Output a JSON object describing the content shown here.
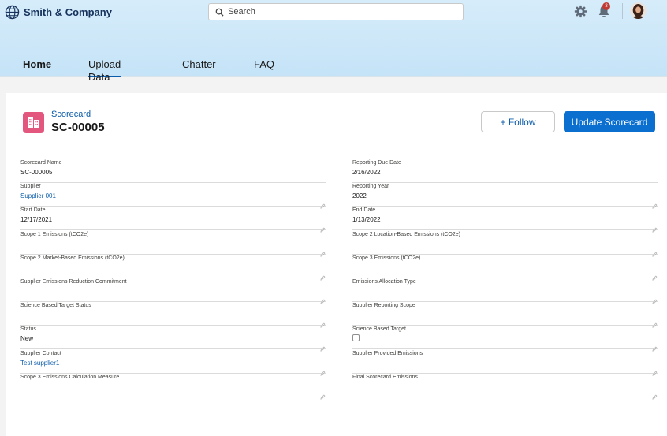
{
  "header": {
    "brand": "Smith & Company",
    "search_placeholder": "Search",
    "notification_count": "3"
  },
  "nav": {
    "items": [
      "Home",
      "Upload Data",
      "Chatter",
      "FAQ"
    ],
    "active": "Upload Data"
  },
  "record": {
    "type_label": "Scorecard",
    "name": "SC-00005",
    "follow_label": "+ Follow",
    "update_label": "Update Scorecard"
  },
  "fields_left": [
    {
      "label": "Scorecard Name",
      "value": "SC-000005"
    },
    {
      "label": "Supplier",
      "value": "Supplier 001"
    },
    {
      "label": "Start Date",
      "value": "12/17/2021"
    },
    {
      "label": "Scope 1 Emissions (tCO2e)",
      "value": ""
    },
    {
      "label": "Scope 2 Market-Based Emissions (tCO2e)",
      "value": ""
    },
    {
      "label": "Supplier Emissions Reduction Commitment",
      "value": ""
    },
    {
      "label": "Science Based Target Status",
      "value": ""
    },
    {
      "label": "Status",
      "value": "New"
    },
    {
      "label": "Supplier Contact",
      "value": "Test supplier1"
    },
    {
      "label": "Scope 3 Emissions Calculation Measure",
      "value": ""
    }
  ],
  "fields_right": [
    {
      "label": "Reporting Due Date",
      "value": "2/16/2022"
    },
    {
      "label": "Reporting Year",
      "value": "2022"
    },
    {
      "label": "End Date",
      "value": "1/13/2022"
    },
    {
      "label": "Scope 2 Location-Based Emissions (tCO2e)",
      "value": ""
    },
    {
      "label": "Scope 3 Emissions (tCO2e)",
      "value": ""
    },
    {
      "label": "Emissions Allocation Type",
      "value": ""
    },
    {
      "label": "Supplier Reporting Scope",
      "value": ""
    },
    {
      "label": "Science Based Target",
      "value": ""
    },
    {
      "label": "Supplier Provided Emissions",
      "value": ""
    },
    {
      "label": "Final Scorecard Emissions",
      "value": ""
    }
  ],
  "colors": {
    "brand_blue": "#0b6fd0",
    "link_blue": "#0b5cab",
    "record_icon": "#e3577f",
    "badge_red": "#c23934"
  }
}
